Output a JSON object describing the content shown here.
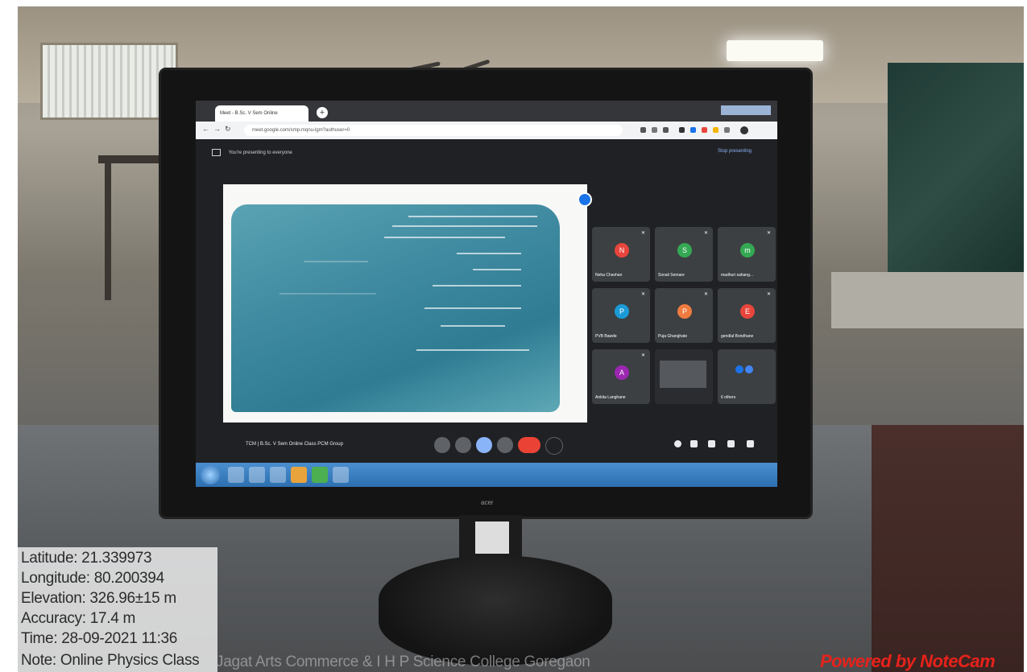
{
  "browser": {
    "tab_title": "Meet - B.Sc. V Sem Online",
    "url": "meet.google.com/xmp-mqnu-lgm?authuser=0"
  },
  "meet": {
    "presenting_text": "You're presenting to everyone",
    "stop_presenting": "Stop presenting",
    "meeting_title": "TCM  |  B.Sc. V Sem Online Class PCM Group",
    "participants": [
      {
        "initial": "N",
        "name": "Neha Chavhan",
        "color": "#e8453c"
      },
      {
        "initial": "S",
        "name": "Sonali Semare",
        "color": "#34a853"
      },
      {
        "initial": "m",
        "name": "madhuri sahang...",
        "color": "#34a853"
      },
      {
        "initial": "P",
        "name": "PVB Bawde",
        "color": "#1a9bd7"
      },
      {
        "initial": "P",
        "name": "Puja Ghanghate",
        "color": "#f07b3f"
      },
      {
        "initial": "E",
        "name": "gendlal Bondhane",
        "color": "#e8453c"
      },
      {
        "initial": "A",
        "name": "Ankita Langhane",
        "color": "#9c27b0"
      },
      {
        "initial": "",
        "name": "",
        "color": "#3c4043"
      },
      {
        "initial": "",
        "name": "6 others",
        "color": "#1a73e8"
      }
    ]
  },
  "geotag": {
    "latitude": "Latitude: 21.339973",
    "longitude": "Longitude: 80.200394",
    "elevation": "Elevation: 326.96±15 m",
    "accuracy": "Accuracy: 17.4 m",
    "time": "Time: 28-09-2021 11:36",
    "note": "Note: Online Physics Class",
    "note_tail": "Jagat Arts Commerce & I H P Science College Goregaon"
  },
  "watermark": "Powered by NoteCam",
  "monitor_brand": "acer"
}
